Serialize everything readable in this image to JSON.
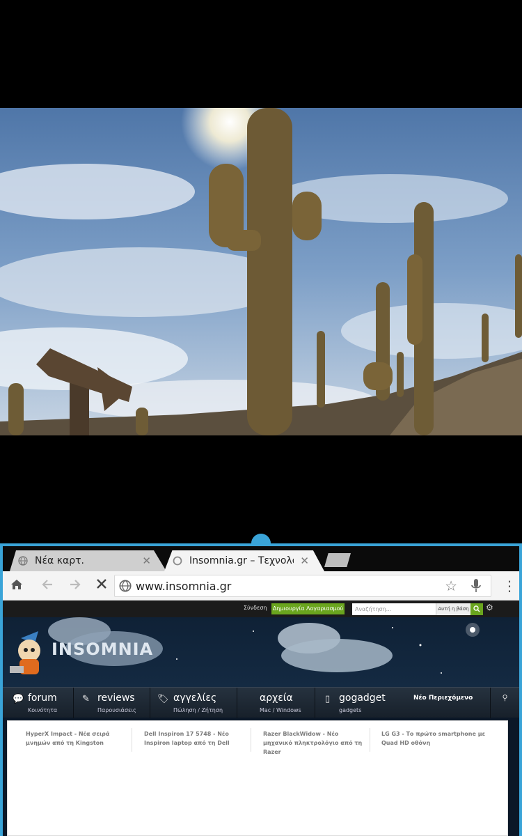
{
  "browser": {
    "tabs": [
      {
        "title": "Νέα καρτ.",
        "close": "✕"
      },
      {
        "title": "Insomnia.gr – Τεχνολογία",
        "close": "✕"
      }
    ],
    "url": "www.insomnia.gr"
  },
  "site": {
    "topbar": {
      "login": "Σύνδεση",
      "register": "Δημιουργία Λογαριασμού",
      "search_placeholder": "Αναζήτηση...",
      "search_scope": "Αυτή η βάση"
    },
    "logo": "INSOMNIA",
    "nav": [
      {
        "label": "forum",
        "sub": "Κοινότητα"
      },
      {
        "label": "reviews",
        "sub": "Παρουσιάσεις"
      },
      {
        "label": "αγγελίες",
        "sub": "Πώληση / Ζήτηση"
      },
      {
        "label": "αρχεία",
        "sub": "Mac / Windows"
      },
      {
        "label": "gogadget",
        "sub": "gadgets"
      }
    ],
    "nav_new": "Νέο Περιεχόμενο",
    "headlines": [
      "HyperX Impact - Νέα σειρά μνημών από τη Kingston",
      "Dell Inspiron 17 5748 - Νέο Inspiron laptop από τη Dell",
      "Razer BlackWidow - Νέο μηχανικό πληκτρολόγιο από τη Razer",
      "LG G3 - Το πρώτο smartphone με Quad HD οθόνη"
    ]
  },
  "colors": {
    "accent": "#3aa4d8",
    "register_green": "#6aa51e",
    "nav_dark": "#1d2732"
  }
}
